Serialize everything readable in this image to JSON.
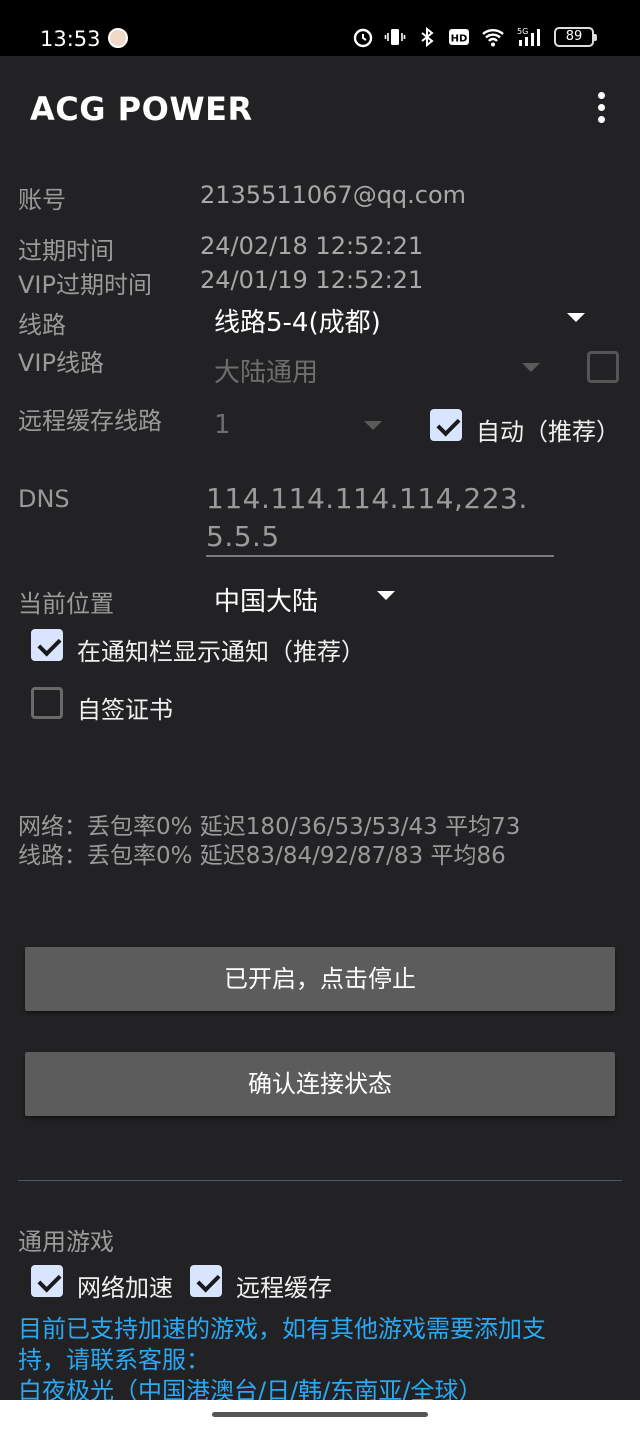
{
  "status_bar": {
    "time": "13:53",
    "battery": "89",
    "icons": [
      "avatar-icon",
      "alarm-icon",
      "vibrate-icon",
      "bluetooth-icon",
      "hd-icon",
      "wifi-icon",
      "signal-5g-icon",
      "battery-icon"
    ]
  },
  "app_bar": {
    "title": "ACG POWER",
    "menu_icon": "more-vert-icon"
  },
  "account": {
    "label": "账号",
    "value": "2135511067@qq.com"
  },
  "expire": {
    "label": "过期时间",
    "value": "24/02/18 12:52:21"
  },
  "vip_expire": {
    "label": "VIP过期时间",
    "value": "24/01/19 12:52:21"
  },
  "route": {
    "label": "线路",
    "selected": "线路5-4(成都)"
  },
  "vip_route": {
    "label": "VIP线路",
    "selected": "大陆通用",
    "checked": false
  },
  "remote_cache": {
    "label": "远程缓存线路",
    "selected": "1",
    "auto_label": "自动（推荐）",
    "auto_checked": true
  },
  "dns": {
    "label": "DNS",
    "value": "114.114.114.114,223.5.5.5"
  },
  "location": {
    "label": "当前位置",
    "selected": "中国大陆"
  },
  "options": {
    "notify_label": "在通知栏显示通知（推荐）",
    "notify_checked": true,
    "self_cert_label": "自签证书",
    "self_cert_checked": false
  },
  "stats": {
    "network": "网络：丢包率0% 延迟180/36/53/53/43 平均73",
    "route": "线路：丢包率0% 延迟83/84/92/87/83 平均86"
  },
  "buttons": {
    "toggle": "已开启，点击停止",
    "check": "确认连接状态"
  },
  "general_games": {
    "title": "通用游戏",
    "net_accel_label": "网络加速",
    "net_accel_checked": true,
    "remote_cache_label": "远程缓存",
    "remote_cache_checked": true
  },
  "info": {
    "line1": "目前已支持加速的游戏，如有其他游戏需要添加支",
    "line2": "持，请联系客服：",
    "line3": "白夜极光（中国港澳台/日/韩/东南亚/全球）"
  },
  "colors": {
    "background": "#222224",
    "accent_link": "#2aa8f2",
    "button": "#5c5c5c",
    "checkbox_checked": "#d9e4ff"
  }
}
